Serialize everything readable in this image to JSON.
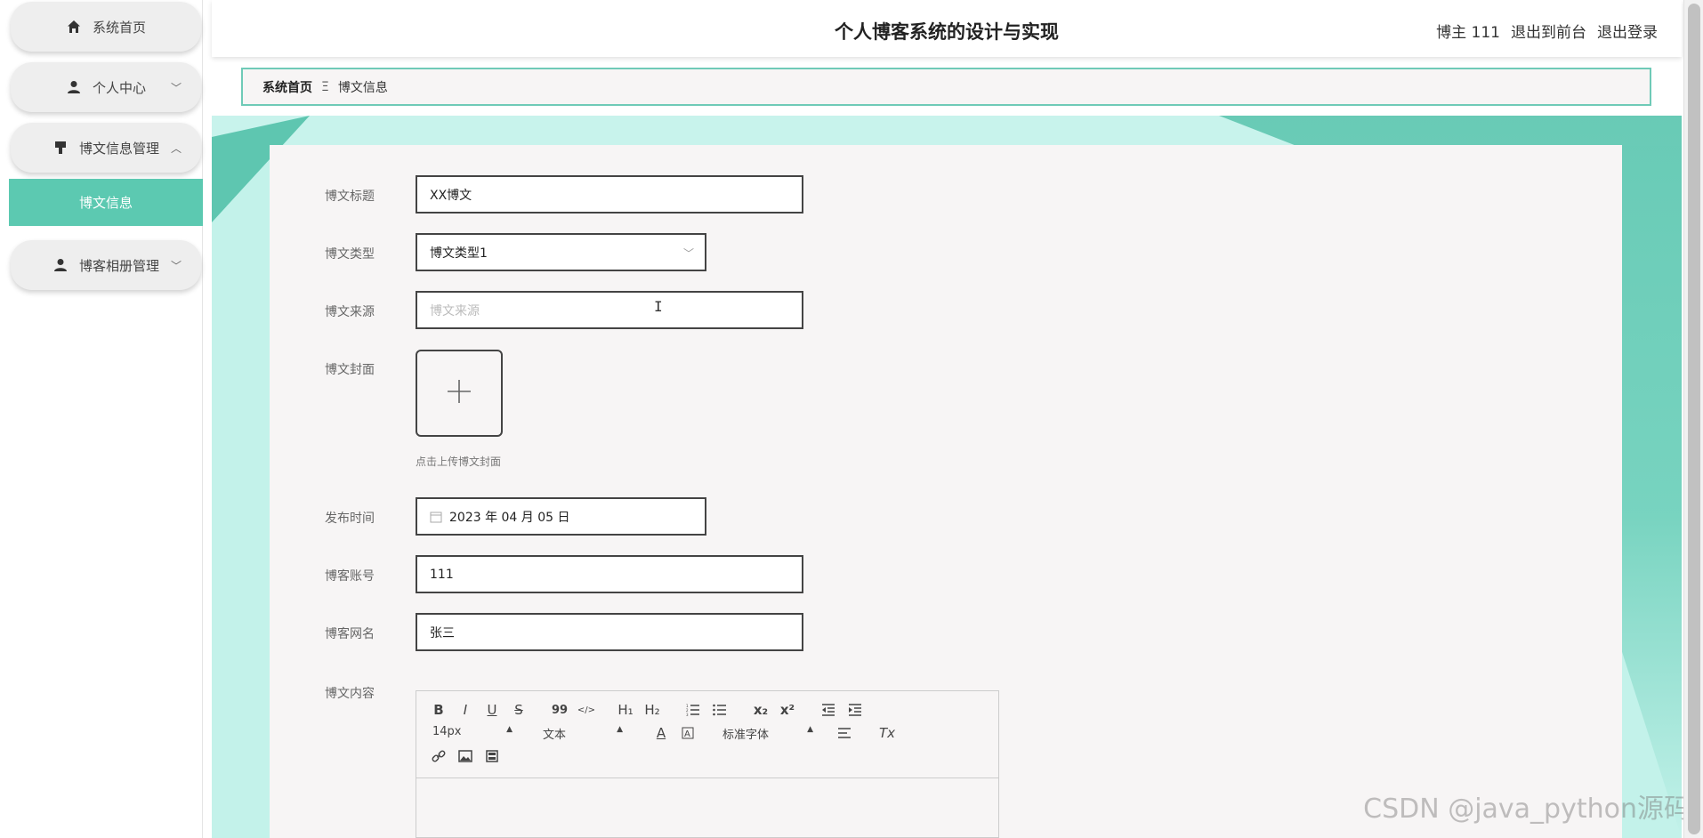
{
  "app_title": "个人博客系统的设计与实现",
  "header": {
    "user_label": "博主 111",
    "to_front_label": "退出到前台",
    "logout_label": "退出登录"
  },
  "sidebar": {
    "items": [
      {
        "label": "系统首页",
        "icon": "home-icon"
      },
      {
        "label": "个人中心",
        "icon": "user-icon",
        "chevron": "﹀"
      },
      {
        "label": "博文信息管理",
        "icon": "brush-icon",
        "chevron": "︿"
      },
      {
        "label": "博客相册管理",
        "icon": "user-icon",
        "chevron": "﹀"
      }
    ],
    "active_sub": "博文信息"
  },
  "breadcrumb": {
    "home": "系统首页",
    "separator": "Ξ",
    "current": "博文信息"
  },
  "form": {
    "title_label": "博文标题",
    "title_value": "XX博文",
    "type_label": "博文类型",
    "type_value": "博文类型1",
    "source_label": "博文来源",
    "source_placeholder": "博文来源",
    "cover_label": "博文封面",
    "cover_tip": "点击上传博文封面",
    "publish_label": "发布时间",
    "publish_value": "2023 年 04 月 05 日",
    "account_label": "博客账号",
    "account_value": "111",
    "nickname_label": "博客网名",
    "nickname_value": "张三",
    "content_label": "博文内容"
  },
  "editor": {
    "font_size": "14px",
    "text_style": "文本",
    "font_family": "标准字体",
    "bold": "B",
    "italic": "I",
    "underline": "U",
    "strike": "S",
    "quote": "99",
    "code": "</>",
    "h1": "H₁",
    "h2": "H₂",
    "subscript": "x₂",
    "superscript": "x²",
    "color_a": "A",
    "clear": "Tx"
  },
  "watermark": "CSDN @java_python源码",
  "colors": {
    "accent": "#5cc9b1",
    "breadcrumb_border": "#6fcab7",
    "card_bg": "#f7f5f5"
  }
}
